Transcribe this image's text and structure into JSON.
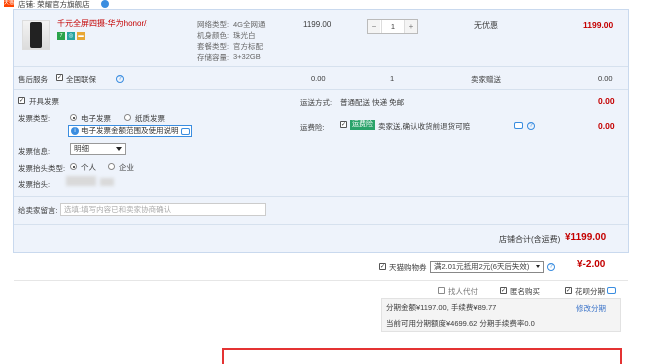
{
  "shop": {
    "tag": "天猫",
    "name": "店铺: 荣耀官方旗舰店"
  },
  "item": {
    "title": "千元全屏四摄-华为honor/荣耀...",
    "attrs": [
      {
        "label": "网络类型:",
        "value": "4G全网通"
      },
      {
        "label": "机身颜色:",
        "value": "珠光白"
      },
      {
        "label": "套餐类型:",
        "value": "官方标配"
      },
      {
        "label": "存储容量:",
        "value": "3+32GB"
      }
    ],
    "unit_price": "1199.00",
    "quantity": "1",
    "discount": "无优惠",
    "subtotal": "1199.00"
  },
  "service": {
    "label": "售后服务",
    "name": "全国联保",
    "price": "0.00",
    "qty": "1",
    "gift": "卖家赠送",
    "subtotal": "0.00"
  },
  "invoice": {
    "open_label": "开具发票",
    "type_label": "发票类型:",
    "type_options": [
      "电子发票",
      "纸质发票"
    ],
    "tip": "电子发票金额范围及使用说明",
    "info_label": "发票信息:",
    "info_value": "明细",
    "header_type_label": "发票抬头类型:",
    "header_type_options": [
      "个人",
      "企业"
    ],
    "header_label": "发票抬头:"
  },
  "shipping": {
    "method_label": "运送方式:",
    "method_value": "普通配送 快递 免邮",
    "method_price": "0.00",
    "insurance_label": "运费险:",
    "insurance_badge": "运费险",
    "insurance_desc": "卖家送,确认收货前退货可赔",
    "insurance_price": "0.00"
  },
  "message": {
    "label": "给卖家留言:",
    "placeholder": "选填:填写内容已和卖家协商确认"
  },
  "total": {
    "label": "店铺合计(含运费)",
    "value": "¥1199.00"
  },
  "coupon": {
    "label": "天猫购物券",
    "select": "满2.01元抵用2元(6天后失效)",
    "value": "¥-2.00"
  },
  "options": {
    "proxy": "找人代付",
    "anonymous": "匿名购买",
    "huabei": "花呗分期"
  },
  "installment": {
    "line1": "分期金额¥1197.00, 手续费¥89.77",
    "line2": "当前可用分期额度¥4699.62 分期手续费率0.0",
    "modify": "修改分期"
  },
  "colors": {
    "accent": "#c40000",
    "link": "#3a73c9",
    "panel": "#eef3fb"
  }
}
